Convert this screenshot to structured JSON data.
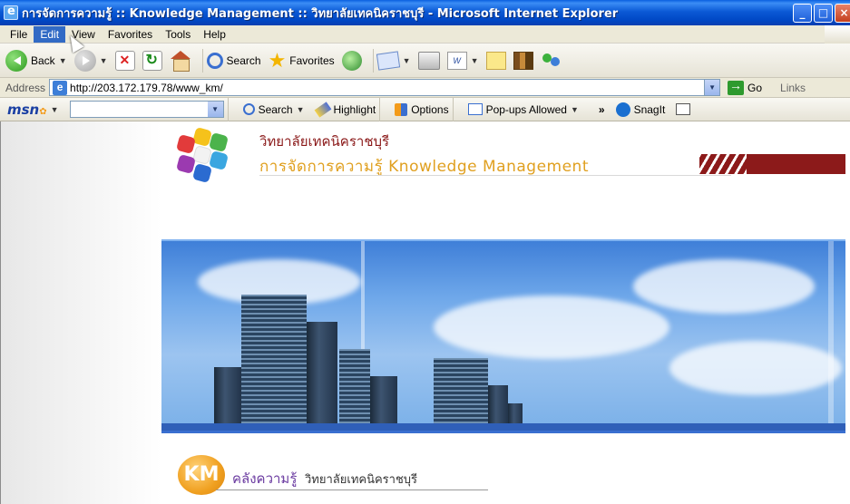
{
  "window": {
    "title": "การจัดการความรู้ :: Knowledge Management :: วิทยาลัยเทคนิคราชบุรี - Microsoft Internet Explorer"
  },
  "menu": [
    "File",
    "Edit",
    "View",
    "Favorites",
    "Tools",
    "Help"
  ],
  "toolbar": {
    "back_label": "Back",
    "search_label": "Search",
    "favorites_label": "Favorites"
  },
  "address": {
    "label": "Address",
    "url": "http://203.172.179.78/www_km/",
    "go_label": "Go",
    "links_label": "Links"
  },
  "msn": {
    "logo": "msn",
    "search_value": "",
    "search_label": "Search",
    "highlight_label": "Highlight",
    "options_label": "Options",
    "popups_label": "Pop-ups Allowed",
    "snagit_label": "SnagIt"
  },
  "page": {
    "site_name": "วิทยาลัยเทคนิคราชบุรี",
    "site_subtitle": "การจัดการความรู้  Knowledge Management",
    "km_badge": "KM",
    "km_title": "คลังความรู้",
    "km_subtitle": "วิทยาลัยเทคนิคราชบุรี"
  },
  "colors": {
    "titlebar": "#0b5ad6",
    "site_name": "#8a1818",
    "site_subtitle": "#e0a020",
    "header_band": "#8c1a1a",
    "km_badge": "#f0a020"
  }
}
